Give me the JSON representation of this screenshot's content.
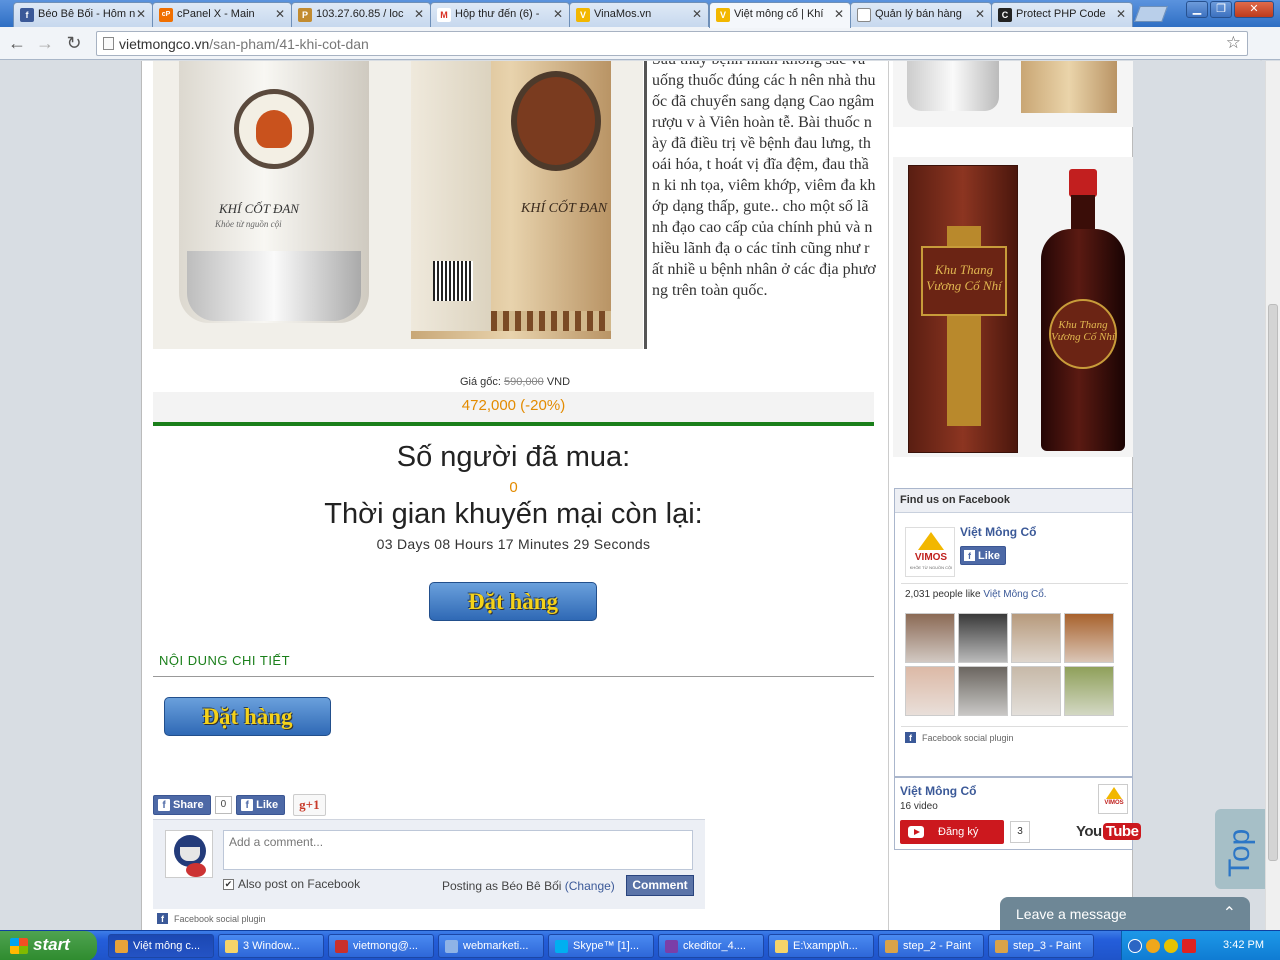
{
  "browser": {
    "tabs": [
      {
        "title": "Béo Bê Bối - Hôm n",
        "color": "#3b5998",
        "glyph": "f"
      },
      {
        "title": "cPanel X - Main",
        "color": "#f06f00",
        "glyph": "cP"
      },
      {
        "title": "103.27.60.85 / loc",
        "color": "#c28b2f",
        "glyph": "P"
      },
      {
        "title": "Hộp thư đến (6) -",
        "color": "#d93025",
        "glyph": "M"
      },
      {
        "title": "VinaMos.vn",
        "color": "#f2b700",
        "glyph": "V"
      },
      {
        "title": "Việt mông cổ | Khí",
        "color": "#f2b700",
        "glyph": "V"
      },
      {
        "title": "Quản lý bán hàng",
        "color": "#ffffff",
        "glyph": ""
      },
      {
        "title": "Protect PHP Code",
        "color": "#222222",
        "glyph": "C"
      }
    ],
    "active_tab": 5,
    "url_domain": "vietmongco.vn",
    "url_path": "/san-pham/41-khi-cot-dan"
  },
  "product": {
    "jar_brand": "KHÍ CỐT ĐAN",
    "jar_slogan": "Khỏe từ nguồn cội",
    "description": "Sau thấy bệnh nhân không sắc và uống thuốc đúng các h nên nhà thuốc đã chuyển sang dạng Cao ngâm rượu v à Viên hoàn tễ. Bài thuốc này đã điều trị về bệnh đau lưng, thoái hóa, t hoát vị đĩa đệm, đau thần ki nh tọa, viêm khớp, viêm đa khớp dạng thấp, gute.. cho một số lãnh đạo cao cấp của chính phủ và nhiều lãnh đạ o các tỉnh cũng như rất nhiề u bệnh nhân ở các địa phươ ng trên toàn quốc.",
    "price_label": "Giá gốc:",
    "price_original": "590,000",
    "price_currency": "VND",
    "price_sale": "472,000 (-20%)",
    "buyers_title": "Số người đã mua:",
    "buyers_count": "0",
    "promo_title": "Thời gian khuyến mại còn lại:",
    "countdown": "03 Days 08 Hours 17 Minutes 29 Seconds",
    "order_label": "Đặt hàng",
    "details_title": "NỘI DUNG CHI TIẾT"
  },
  "social": {
    "share_label": "Share",
    "share_count": "0",
    "like_label": "Like",
    "gplus_label": "g+1",
    "comment_placeholder": "Add a comment...",
    "also_post": "Also post on Facebook",
    "posting_as": "Posting as Béo Bê Bối",
    "change_label": "(Change)",
    "comment_button": "Comment",
    "plugin_label": "Facebook social plugin"
  },
  "sidebar": {
    "wine_label": "Khu Thang Vương Cổ Nhí",
    "fb_header": "Find us on Facebook",
    "fb_page_name": "Việt Mông Cổ",
    "fb_logo_text": "VIMOS",
    "fb_logo_tagline": "KHỎE TỪ NGUỒN CỘI",
    "fb_like": "Like",
    "fb_count_text": "2,031 people like",
    "fb_count_name": "Việt Mông Cổ.",
    "fb_plugin": "Facebook social plugin",
    "face_colors": [
      "#8b6a55",
      "#3a3a3a",
      "#b79a7c",
      "#a8622d",
      "#dcb9a6",
      "#6b6660",
      "#c7b9a8",
      "#8fa05a"
    ],
    "yt_name": "Việt Mông Cổ",
    "yt_videos": "16 video",
    "yt_subscribe": "Đăng ký",
    "yt_sub_count": "3",
    "yt_logo_you": "You",
    "yt_logo_tube": "Tube"
  },
  "widgets": {
    "top_label": "Top",
    "leave_message": "Leave a message"
  },
  "taskbar": {
    "start": "start",
    "tasks": [
      {
        "label": "Việt mông c...",
        "color": "#e8a33a"
      },
      {
        "label": "3 Window...",
        "color": "#f5d46a"
      },
      {
        "label": "vietmong@...",
        "color": "#c9302c"
      },
      {
        "label": "webmarketi...",
        "color": "#8fb3e6"
      },
      {
        "label": "Skype™ [1]...",
        "color": "#00aff0"
      },
      {
        "label": "ckeditor_4....",
        "color": "#7b3ea8"
      },
      {
        "label": "E:\\xampp\\h...",
        "color": "#f5d46a"
      },
      {
        "label": "step_2 - Paint",
        "color": "#d9a34a"
      },
      {
        "label": "step_3 - Paint",
        "color": "#d9a34a"
      }
    ],
    "clock": "3:42 PM"
  }
}
